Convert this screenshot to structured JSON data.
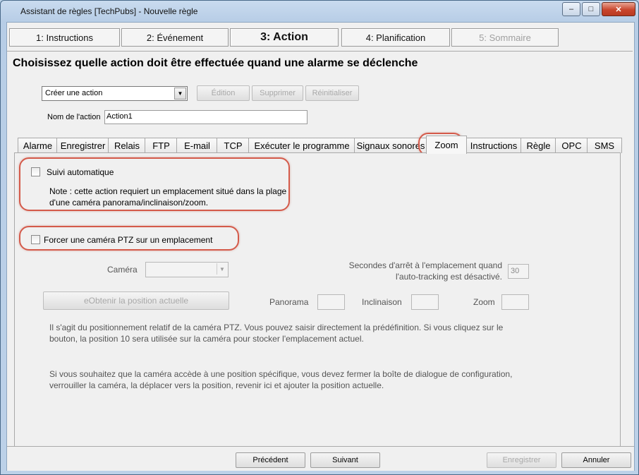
{
  "window": {
    "title": "Assistant de règles [TechPubs] - Nouvelle règle",
    "controls": {
      "minimize": "–",
      "maximize": "□",
      "close": "✕"
    }
  },
  "steps": [
    {
      "label": "1: Instructions",
      "state": "normal"
    },
    {
      "label": "2: Événement",
      "state": "normal"
    },
    {
      "label": "3: Action",
      "state": "active"
    },
    {
      "label": "4: Planification",
      "state": "normal"
    },
    {
      "label": "5: Sommaire",
      "state": "disabled"
    }
  ],
  "heading": "Choisissez quelle action doit être effectuée quand une alarme se déclenche",
  "action_selector": {
    "selected": "Créer une action",
    "edit_label": "Édition",
    "delete_label": "Supprimer",
    "reset_label": "Réinitialiser"
  },
  "action_name": {
    "label": "Nom de l'action",
    "value": "Action1"
  },
  "tabs": [
    "Alarme",
    "Enregistrer",
    "Relais",
    "FTP",
    "E-mail",
    "TCP",
    "Exécuter le programme",
    "Signaux sonores",
    "Zoom",
    "Instructions",
    "Règle",
    "OPC",
    "SMS"
  ],
  "selected_tab": "Zoom",
  "zoom": {
    "auto_tracking_label": "Suivi automatique",
    "note": "Note : cette action requiert un emplacement situé dans la plage d'une caméra panorama/inclinaison/zoom.",
    "force_ptz_label": "Forcer une caméra PTZ sur un emplacement",
    "camera_label": "Caméra",
    "camera_value": "",
    "seconds_label": "Secondes d'arrêt à l'emplacement quand l'auto-tracking est désactivé.",
    "seconds_value": "30",
    "get_position_button": "eObtenir la position actuelle",
    "pan_label": "Panorama",
    "pan_value": "",
    "tilt_label": "Inclinaison",
    "tilt_value": "",
    "zoom_label": "Zoom",
    "zoom_value": "",
    "info_1": "Il s'agit du positionnement relatif de la caméra PTZ. Vous pouvez saisir directement la prédéfinition. Si vous cliquez sur le bouton, la position 10 sera utilisée sur la caméra pour stocker l'emplacement actuel.",
    "info_2": "Si vous souhaitez que la caméra accède à une position spécifique, vous devez fermer la boîte de dialogue de configuration, verrouiller la caméra, la déplacer vers la position, revenir ici et ajouter la position actuelle."
  },
  "footer": {
    "previous": "Précédent",
    "next": "Suivant",
    "save": "Enregistrer",
    "cancel": "Annuler"
  },
  "colors": {
    "highlight_ring": "#d45a4a",
    "window_frame": "#bcd3ea"
  }
}
